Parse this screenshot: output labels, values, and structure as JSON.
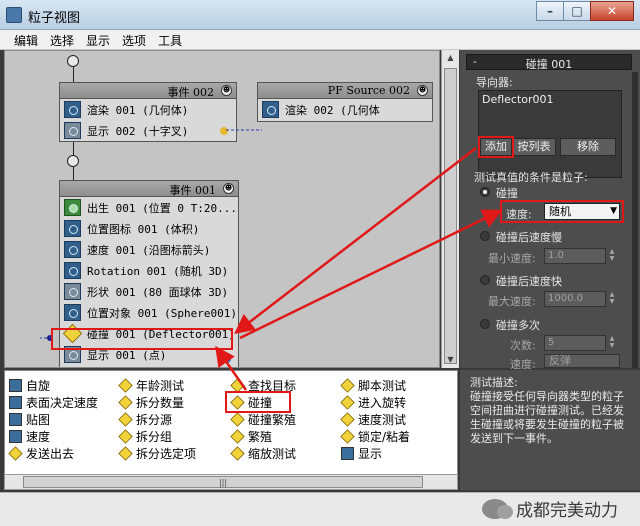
{
  "window": {
    "title": "粒子视图"
  },
  "menu": [
    "编辑",
    "选择",
    "显示",
    "选项",
    "工具"
  ],
  "event_002": {
    "header": "事件 002",
    "ops": [
      "渲染 001 (几何体)",
      "显示 002 (十字叉)"
    ]
  },
  "pf_source": {
    "header": "PF Source 002",
    "ops": [
      "渲染 002 (几何体"
    ]
  },
  "event_001": {
    "header": "事件 001",
    "ops": [
      "出生 001 (位置 0 T:20...",
      "位置图标 001 (体积)",
      "速度 001 (沿图标箭头)",
      "Rotation 001 (随机 3D)",
      "形状 001 (80 面球体 3D)",
      "位置对象 001 (Sphere001)",
      "碰撞 001 (Deflector001)",
      "显示 001 (点)"
    ]
  },
  "panel": {
    "rollout_title": "碰撞 001",
    "deflectors_label": "导向器:",
    "deflector_item": "Deflector001",
    "btn_add": "添加",
    "btn_by_list": "按列表",
    "btn_remove": "移除",
    "condition_label": "测试真值的条件是粒子:",
    "opt_collide": "碰撞",
    "speed_label": "速度:",
    "speed_value": "随机",
    "opt_slow": "碰撞后速度慢",
    "min_speed_label": "最小速度:",
    "min_speed_value": "1.0",
    "opt_fast": "碰撞后速度快",
    "max_speed_label": "最大速度:",
    "max_speed_value": "1000.0",
    "opt_multi": "碰撞多次",
    "times_label": "次数:",
    "times_value": "5",
    "speed2_label": "速度:",
    "speed2_value": "反弹"
  },
  "depot": {
    "col1": [
      "自旋",
      "表面决定速度",
      "贴图",
      "速度",
      "发送出去"
    ],
    "col2": [
      "年龄测试",
      "拆分数量",
      "拆分源",
      "拆分组",
      "拆分选定项"
    ],
    "col3": [
      "查找目标",
      "碰撞",
      "碰撞繁殖",
      "繁殖",
      "缩放测试"
    ],
    "col4": [
      "脚本测试",
      "进入旋转",
      "速度测试",
      "锁定/粘着",
      "显示"
    ]
  },
  "description": {
    "title": "测试描述:",
    "body": "碰撞接受任何导向器类型的粒子空间扭曲进行碰撞测试。已经发生碰撞或将要发生碰撞的粒子被发送到下一事件。"
  },
  "watermark": "成都完美动力",
  "colors": {
    "highlight": "#e01818",
    "panel_bg": "#4d4d4d",
    "canvas_bg": "#c4c4c4"
  }
}
